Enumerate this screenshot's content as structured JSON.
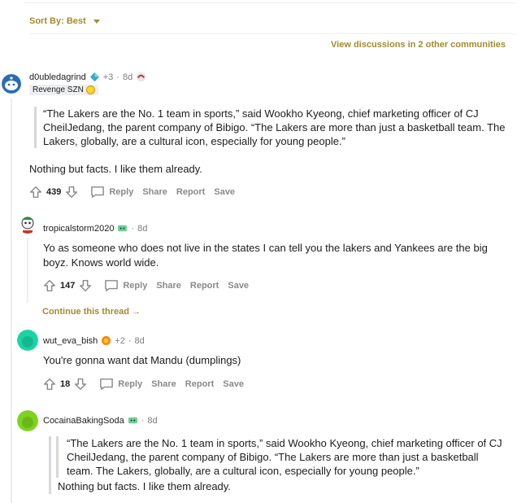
{
  "sort": {
    "label": "Sort By: Best"
  },
  "view_discussions": "View discussions in 2 other communities",
  "comments": [
    {
      "user": "d0ubledagrind",
      "karma_badge": "+3",
      "age": "8d",
      "flair": "Revenge SZN",
      "quote": "“The Lakers are the No. 1 team in sports,” said Wookho Kyeong, chief marketing officer of CJ CheilJedang, the parent company of Bibigo. “The Lakers are more than just a basketball team. The Lakers, globally, are a cultural icon, especially for young people.”",
      "body": "Nothing but facts. I like them already.",
      "score": "439",
      "actions": {
        "reply": "Reply",
        "share": "Share",
        "report": "Report",
        "save": "Save"
      }
    },
    {
      "user": "tropicalstorm2020",
      "age": "8d",
      "body": "Yo as someone who does not live in the states I can tell you the lakers and Yankees are the big boyz. Knows world wide.",
      "score": "147",
      "actions": {
        "reply": "Reply",
        "share": "Share",
        "report": "Report",
        "save": "Save"
      }
    },
    {
      "user": "wut_eva_bish",
      "karma_badge": "+2",
      "age": "8d",
      "body": "You're gonna want dat Mandu (dumplings)",
      "score": "18",
      "actions": {
        "reply": "Reply",
        "share": "Share",
        "report": "Report",
        "save": "Save"
      }
    },
    {
      "user": "CocainaBakingSoda",
      "age": "8d",
      "quote": "“The Lakers are the No. 1 team in sports,” said Wookho Kyeong, chief marketing officer of CJ CheilJedang, the parent company of Bibigo. “The Lakers are more than just a basketball team. The Lakers, globally, are a cultural icon, especially for young people.”",
      "nested_quote": "Nothing but facts. I like them already."
    }
  ],
  "continue_thread": "Continue this thread",
  "dot": "·",
  "colors": {
    "accent": "#a28b2e",
    "muted": "#878a8c",
    "line": "#edeff1"
  }
}
